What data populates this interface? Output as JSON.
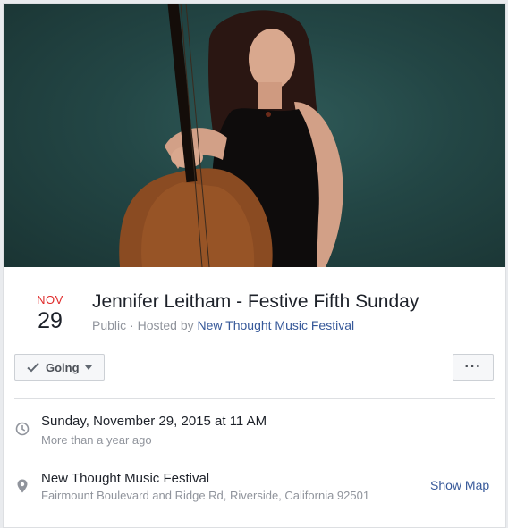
{
  "event": {
    "month": "NOV",
    "day": "29",
    "title": "Jennifer Leitham - Festive Fifth Sunday",
    "privacy": "Public",
    "hosted_by_prefix": " · Hosted by ",
    "host": "New Thought Music Festival"
  },
  "actions": {
    "going_label": "Going",
    "more_label": "···"
  },
  "details": {
    "datetime": "Sunday, November 29, 2015 at 11 AM",
    "relative_time": "More than a year ago",
    "venue": "New Thought Music Festival",
    "address": "Fairmount Boulevard and Ridge Rd, Riverside, California 92501",
    "show_map_label": "Show Map"
  },
  "icons": {
    "check": "check-icon",
    "caret": "caret-down-icon",
    "clock": "clock-icon",
    "pin": "map-pin-icon"
  },
  "colors": {
    "month_red": "#e02a2a",
    "link_blue": "#365899",
    "cover_teal": "#234645"
  }
}
